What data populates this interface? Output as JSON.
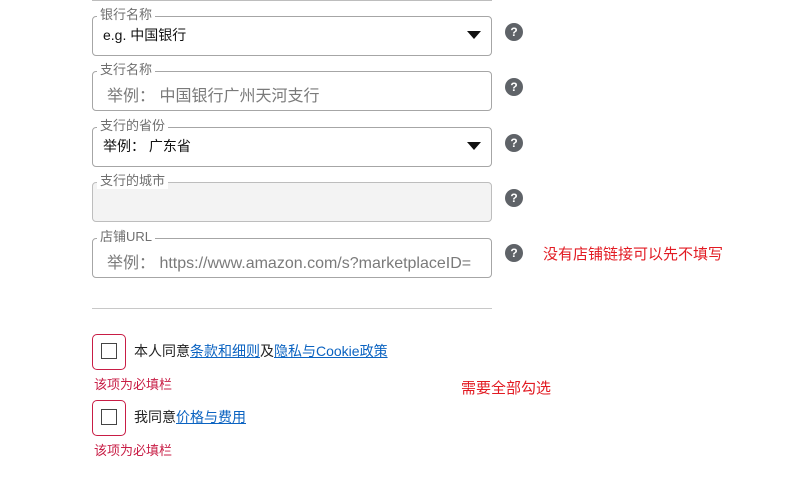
{
  "fields": {
    "bank_name": {
      "legend": "银行名称",
      "value": "e.g. 中国银行"
    },
    "branch_name": {
      "legend": "支行名称",
      "placeholder": "举例： 中国银行广州天河支行"
    },
    "branch_province": {
      "legend": "支行的省份",
      "value": "举例： 广东省"
    },
    "branch_city": {
      "legend": "支行的城市"
    },
    "store_url": {
      "legend": "店铺URL",
      "placeholder": "举例： https://www.amazon.com/s?marketplaceID="
    }
  },
  "help_glyph": "?",
  "notes": {
    "store_link": "没有店铺链接可以先不填写",
    "select_all": "需要全部勾选"
  },
  "agreements": [
    {
      "prefix": "本人同意",
      "link1": "条款和细则",
      "middle": "及",
      "link2": "隐私与Cookie政策",
      "error": "该项为必填栏"
    },
    {
      "prefix": "我同意",
      "link1": "价格与费用",
      "error": "该项为必填栏"
    }
  ],
  "colors": {
    "note_red": "#e21b23",
    "error_red": "#c81d45",
    "link_blue": "#0b63c1"
  }
}
